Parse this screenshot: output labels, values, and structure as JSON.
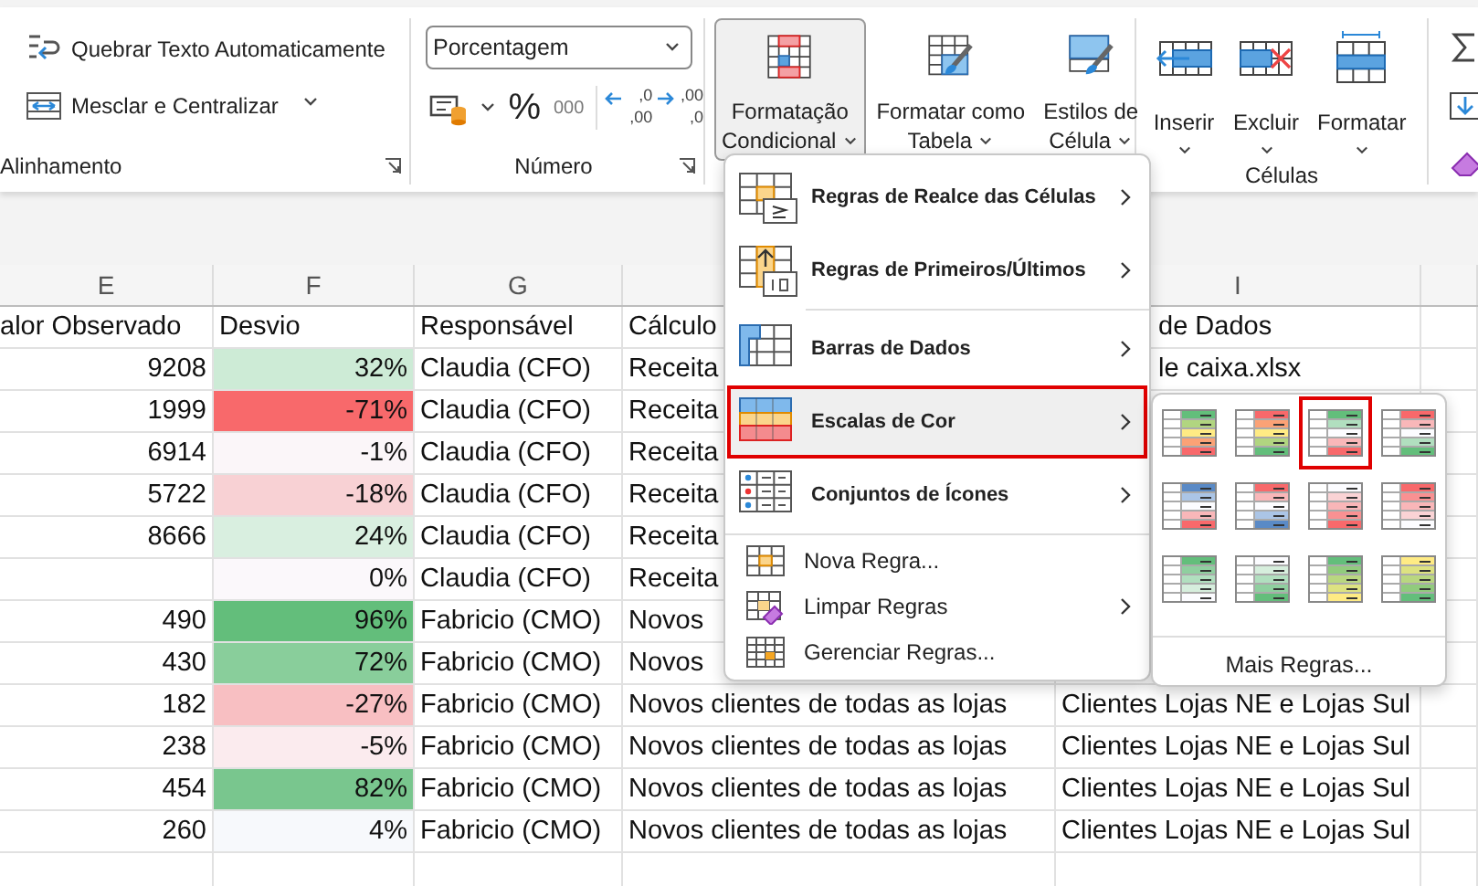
{
  "ribbon": {
    "alignment": {
      "wrap_text": "Quebrar Texto Automaticamente",
      "merge": "Mesclar e Centralizar",
      "label": "Alinhamento"
    },
    "number": {
      "format": "Porcentagem",
      "percent": "%",
      "thousands": "000",
      "decimals": [
        {
          "top": ",0",
          "bottom": ",00"
        },
        {
          "top": ",00",
          "bottom": ",0"
        }
      ],
      "label": "Número"
    },
    "styles": {
      "buttons": [
        {
          "lines": [
            "Formatação",
            "Condicional"
          ],
          "pressed": true
        },
        {
          "lines": [
            "Formatar como",
            "Tabela"
          ],
          "pressed": false
        },
        {
          "lines": [
            "Estilos de",
            "Célula"
          ],
          "pressed": false
        }
      ]
    },
    "cells": {
      "buttons": [
        {
          "label": "Inserir"
        },
        {
          "label": "Excluir"
        },
        {
          "label": "Formatar"
        }
      ],
      "label": "Células"
    }
  },
  "sheet": {
    "columns": [
      {
        "letter": "E"
      },
      {
        "letter": "F"
      },
      {
        "letter": "G"
      },
      {},
      {
        "letter": "I"
      },
      {}
    ],
    "header": [
      "alor Observado",
      "Desvio",
      "Responsável",
      "Cálculo",
      "de Dados"
    ],
    "rows": [
      {
        "observed": "9208",
        "deviation": "32%",
        "color": "#cdebd6",
        "owner": "Claudia (CFO)",
        "calculation": "Receita",
        "source": "le caixa.xlsx"
      },
      {
        "observed": "1999",
        "deviation": "-71%",
        "color": "#f8696b",
        "owner": "Claudia (CFO)",
        "calculation": "Receita"
      },
      {
        "observed": "6914",
        "deviation": "-1%",
        "color": "#fbf6f9",
        "owner": "Claudia (CFO)",
        "calculation": "Receita"
      },
      {
        "observed": "5722",
        "deviation": "-18%",
        "color": "#f8d1d4",
        "owner": "Claudia (CFO)",
        "calculation": "Receita"
      },
      {
        "observed": "8666",
        "deviation": "24%",
        "color": "#d9efe0",
        "owner": "Claudia (CFO)",
        "calculation": "Receita"
      },
      {
        "deviation": "0%",
        "color": "#fbf8fb",
        "owner": "Claudia (CFO)",
        "calculation": "Receita"
      },
      {
        "observed": "490",
        "deviation": "96%",
        "color": "#63be7b",
        "owner": "Fabricio (CMO)",
        "calculation": "Novos"
      },
      {
        "observed": "430",
        "deviation": "72%",
        "color": "#89ce9b",
        "owner": "Fabricio (CMO)",
        "calculation": "Novos"
      },
      {
        "observed": "182",
        "deviation": "-27%",
        "color": "#f8bfc2",
        "owner": "Fabricio (CMO)",
        "calculation": "Novos clientes de todas as lojas",
        "source": "Clientes Lojas NE e Lojas Sul"
      },
      {
        "observed": "238",
        "deviation": "-5%",
        "color": "#fbebee",
        "owner": "Fabricio (CMO)",
        "calculation": "Novos clientes de todas as lojas",
        "source": "Clientes Lojas NE e Lojas Sul"
      },
      {
        "observed": "454",
        "deviation": "82%",
        "color": "#79c68e",
        "owner": "Fabricio (CMO)",
        "calculation": "Novos clientes de todas as lojas",
        "source": "Clientes Lojas NE e Lojas Sul"
      },
      {
        "observed": "260",
        "deviation": "4%",
        "color": "#f7f9fc",
        "owner": "Fabricio (CMO)",
        "calculation": "Novos clientes de todas as lojas",
        "source": "Clientes Lojas NE e Lojas Sul"
      }
    ]
  },
  "menu": {
    "items": [
      {
        "kind": "rule",
        "label": "Regras de Realce das Células",
        "submenu": true,
        "selected": false
      },
      {
        "kind": "rule",
        "label": "Regras de Primeiros/Últimos",
        "submenu": true,
        "selected": false
      },
      {
        "kind": "rule",
        "label": "Barras de Dados",
        "submenu": true,
        "selected": false
      },
      {
        "kind": "rule",
        "label": "Escalas de Cor",
        "submenu": true,
        "selected": true
      },
      {
        "kind": "rule",
        "label": "Conjuntos de Ícones",
        "submenu": true,
        "selected": false
      },
      {
        "kind": "command",
        "label": "Nova Regra...",
        "submenu": false,
        "selected": false
      },
      {
        "kind": "command",
        "label": "Limpar Regras",
        "submenu": true,
        "selected": false
      },
      {
        "kind": "command",
        "label": "Gerenciar Regras...",
        "submenu": false,
        "selected": false
      }
    ]
  },
  "submenu": {
    "scales": [
      {
        "stripes": [
          {
            "color": "#63be7b"
          },
          {
            "color": "#b1d580"
          },
          {
            "color": "#ffeb84"
          },
          {
            "color": "#fba276"
          },
          {
            "color": "#f8696b"
          }
        ],
        "selected": false
      },
      {
        "stripes": [
          {
            "color": "#f8696b"
          },
          {
            "color": "#fba276"
          },
          {
            "color": "#ffeb84"
          },
          {
            "color": "#b1d580"
          },
          {
            "color": "#63be7b"
          }
        ],
        "selected": false
      },
      {
        "stripes": [
          {
            "color": "#63be7b"
          },
          {
            "color": "#b1dfbf"
          },
          {
            "color": "#fcfcff"
          },
          {
            "color": "#f9b7b9"
          },
          {
            "color": "#f8696b"
          }
        ],
        "selected": true
      },
      {
        "stripes": [
          {
            "color": "#f8696b"
          },
          {
            "color": "#f9b7b9"
          },
          {
            "color": "#fcfcff"
          },
          {
            "color": "#b1dfbf"
          },
          {
            "color": "#63be7b"
          }
        ],
        "selected": false
      },
      {
        "stripes": [
          {
            "color": "#5a8ac6"
          },
          {
            "color": "#abc5e6"
          },
          {
            "color": "#fcfcff"
          },
          {
            "color": "#f9b7b9"
          },
          {
            "color": "#f8696b"
          }
        ],
        "selected": false
      },
      {
        "stripes": [
          {
            "color": "#f8696b"
          },
          {
            "color": "#f9b7b9"
          },
          {
            "color": "#fcfcff"
          },
          {
            "color": "#abc5e6"
          },
          {
            "color": "#5a8ac6"
          }
        ],
        "selected": false
      },
      {
        "stripes": [
          {
            "color": "#fcfcff"
          },
          {
            "color": "#fad3d5"
          },
          {
            "color": "#f9b6b8"
          },
          {
            "color": "#f99192"
          },
          {
            "color": "#f8696b"
          }
        ],
        "selected": false
      },
      {
        "stripes": [
          {
            "color": "#f8696b"
          },
          {
            "color": "#f99192"
          },
          {
            "color": "#f9b6b8"
          },
          {
            "color": "#fad3d5"
          },
          {
            "color": "#fcfcff"
          }
        ],
        "selected": false
      },
      {
        "stripes": [
          {
            "color": "#63be7b"
          },
          {
            "color": "#8fcf9f"
          },
          {
            "color": "#b1dfbf"
          },
          {
            "color": "#d6eedd"
          },
          {
            "color": "#fcfcff"
          }
        ],
        "selected": false
      },
      {
        "stripes": [
          {
            "color": "#fcfcff"
          },
          {
            "color": "#d6eedd"
          },
          {
            "color": "#b1dfbf"
          },
          {
            "color": "#8fcf9f"
          },
          {
            "color": "#63be7b"
          }
        ],
        "selected": false
      },
      {
        "stripes": [
          {
            "color": "#63be7b"
          },
          {
            "color": "#91cb7d"
          },
          {
            "color": "#b9d780"
          },
          {
            "color": "#dde281"
          },
          {
            "color": "#ffeb84"
          }
        ],
        "selected": false
      },
      {
        "stripes": [
          {
            "color": "#ffeb84"
          },
          {
            "color": "#dde281"
          },
          {
            "color": "#b9d780"
          },
          {
            "color": "#91cb7d"
          },
          {
            "color": "#63be7b"
          }
        ],
        "selected": false
      }
    ],
    "more": "Mais Regras..."
  }
}
